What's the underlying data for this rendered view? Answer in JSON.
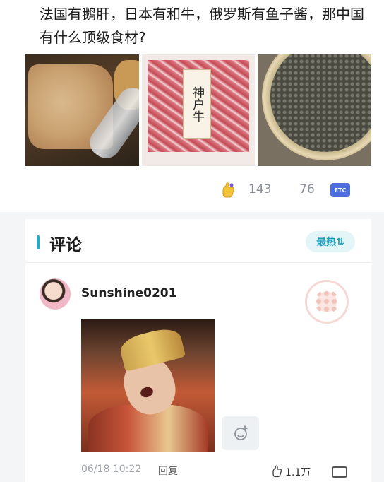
{
  "post": {
    "text": "法国有鹅肝，日本有和牛，俄罗斯有鱼子酱，那中国有什么顶级食材?",
    "images": [
      {
        "icon": "foie-gras-photo"
      },
      {
        "icon": "wagyu-beef-photo",
        "label": "神户牛"
      },
      {
        "icon": "caviar-photo"
      }
    ],
    "stats": {
      "like_count": "143",
      "comment_count": "76",
      "etc_label": "ETC"
    }
  },
  "comments": {
    "section_title": "评论",
    "sort_label": "最热⇅",
    "items": [
      {
        "username": "Sunshine0201",
        "timestamp": "06/18 10:22",
        "reply_label": "回复",
        "like_count": "1.1万"
      }
    ]
  },
  "colors": {
    "accent": "#2aa8c4",
    "etc_badge": "#4c6fdc"
  }
}
